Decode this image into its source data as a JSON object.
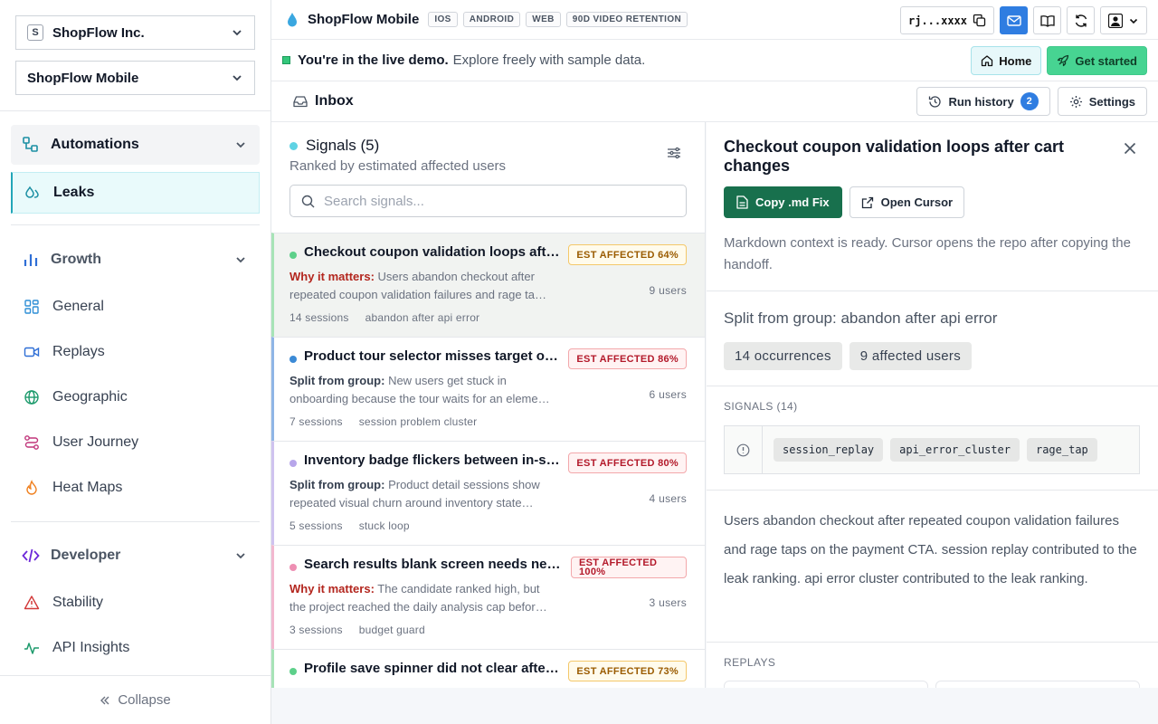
{
  "sidebar": {
    "workspace": {
      "badge": "S",
      "label": "ShopFlow Inc."
    },
    "project": {
      "label": "ShopFlow Mobile"
    },
    "sections": {
      "automations": "Automations",
      "growth": "Growth",
      "developer": "Developer"
    },
    "items": {
      "leaks": "Leaks",
      "general": "General",
      "replays": "Replays",
      "geographic": "Geographic",
      "user_journey": "User Journey",
      "heat_maps": "Heat Maps",
      "stability": "Stability",
      "api_insights": "API Insights"
    },
    "collapse": "Collapse"
  },
  "topbar": {
    "title": "ShopFlow Mobile",
    "tags": [
      "IOS",
      "ANDROID",
      "WEB",
      "90D VIDEO RETENTION"
    ],
    "api_key": "rj...xxxx"
  },
  "banner": {
    "bold": "You're in the live demo.",
    "text": "Explore freely with sample data.",
    "home": "Home",
    "get_started": "Get started"
  },
  "inbox": {
    "title": "Inbox",
    "run_history": "Run history",
    "run_history_count": "2",
    "settings": "Settings"
  },
  "signals": {
    "title": "Signals (5)",
    "subtitle": "Ranked by estimated affected users",
    "search_placeholder": "Search signals...",
    "cards": [
      {
        "title": "Checkout coupon validation loops after cart changes",
        "badge": "EST AFFECTED 64%",
        "lead": "Why it matters:",
        "desc": "Users abandon checkout after repeated coupon validation failures and rage taps on the payment CTA.",
        "users": "9 users",
        "sessions": "14 sessions",
        "tag": "abandon after api error"
      },
      {
        "title": "Product tour selector misses target on small screens",
        "badge": "EST AFFECTED 86%",
        "lead": "Split from group:",
        "desc": "New users get stuck in onboarding because the tour waits for an element that never renders.",
        "users": "6 users",
        "sessions": "7 sessions",
        "tag": "session problem cluster"
      },
      {
        "title": "Inventory badge flickers between in-stock and sold out",
        "badge": "EST AFFECTED 80%",
        "lead": "Split from group:",
        "desc": "Product detail sessions show repeated visual churn around inventory state updates.",
        "users": "4 users",
        "sessions": "5 sessions",
        "tag": "stuck loop"
      },
      {
        "title": "Search results blank screen needs new review",
        "badge": "EST AFFECTED 100%",
        "lead": "Why it matters:",
        "desc": "The candidate ranked high, but the project reached the daily analysis cap before review.",
        "users": "3 users",
        "sessions": "3 sessions",
        "tag": "budget guard"
      },
      {
        "title": "Profile save spinner did not clear after update",
        "badge": "EST AFFECTED 73%",
        "lead": "",
        "desc": "",
        "users": "",
        "sessions": "",
        "tag": ""
      }
    ]
  },
  "detail": {
    "title": "Checkout coupon validation loops after cart changes",
    "copy_btn": "Copy .md Fix",
    "open_btn": "Open Cursor",
    "note": "Markdown context is ready. Cursor opens the repo after copying the handoff.",
    "split": "Split from group: abandon after api error",
    "chips": [
      "14 occurrences",
      "9 affected users"
    ],
    "signals_label": "SIGNALS (14)",
    "tokens": [
      "session_replay",
      "api_error_cluster",
      "rage_tap"
    ],
    "body": "Users abandon checkout after repeated coupon validation failures and rage taps on the payment CTA. session replay contributed to the leak ranking. api error cluster contributed to the leak ranking.",
    "replays_label": "REPLAYS"
  }
}
